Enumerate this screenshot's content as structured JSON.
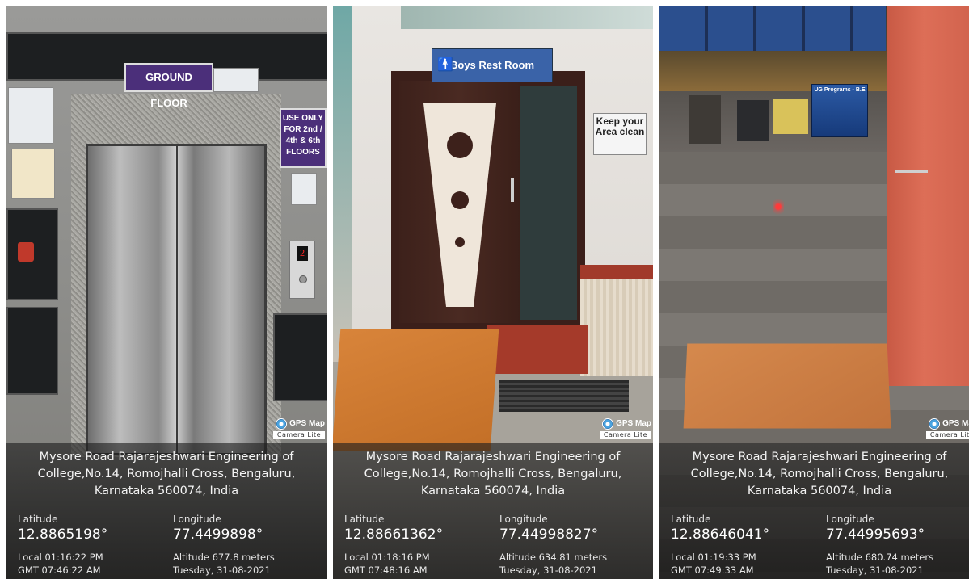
{
  "photos": [
    {
      "signs": [
        "GROUND FLOOR",
        "USE ONLY FOR 2nd / 4th & 6th FLOORS",
        "2"
      ],
      "gps_badge": {
        "title": "GPS Map",
        "subtitle": "Camera Lite"
      },
      "address_lines": [
        "Mysore Road Rajarajeshwari Engineering of",
        "College,No.14, Romojhalli Cross, Bengaluru,",
        "Karnataka 560074, India"
      ],
      "latitude_label": "Latitude",
      "latitude": "12.8865198°",
      "longitude_label": "Longitude",
      "longitude": "77.4499898°",
      "local_time": "Local 01:16:22 PM",
      "gmt_time": "GMT 07:46:22 AM",
      "altitude": "Altitude 677.8 meters",
      "date": "Tuesday, 31-08-2021"
    },
    {
      "signs": [
        "Boys Rest Room",
        "Keep your Area clean"
      ],
      "gps_badge": {
        "title": "GPS Map",
        "subtitle": "Camera Lite"
      },
      "address_lines": [
        "Mysore Road Rajarajeshwari Engineering of",
        "College,No.14, Romojhalli Cross, Bengaluru,",
        "Karnataka 560074, India"
      ],
      "latitude_label": "Latitude",
      "latitude": "12.88661362°",
      "longitude_label": "Longitude",
      "longitude": "77.44998827°",
      "local_time": "Local 01:18:16 PM",
      "gmt_time": "GMT 07:48:16 AM",
      "altitude": "Altitude 634.81 meters",
      "date": "Tuesday, 31-08-2021"
    },
    {
      "signs": [
        "UG Programs - B.E"
      ],
      "gps_badge": {
        "title": "GPS Map",
        "subtitle": "Camera Lite"
      },
      "address_lines": [
        "Mysore Road Rajarajeshwari Engineering of",
        "College,No.14, Romojhalli Cross, Bengaluru,",
        "Karnataka 560074, India"
      ],
      "latitude_label": "Latitude",
      "latitude": "12.88646041°",
      "longitude_label": "Longitude",
      "longitude": "77.44995693°",
      "local_time": "Local 01:19:33 PM",
      "gmt_time": "GMT 07:49:33 AM",
      "altitude": "Altitude 680.74 meters",
      "date": "Tuesday, 31-08-2021"
    }
  ]
}
